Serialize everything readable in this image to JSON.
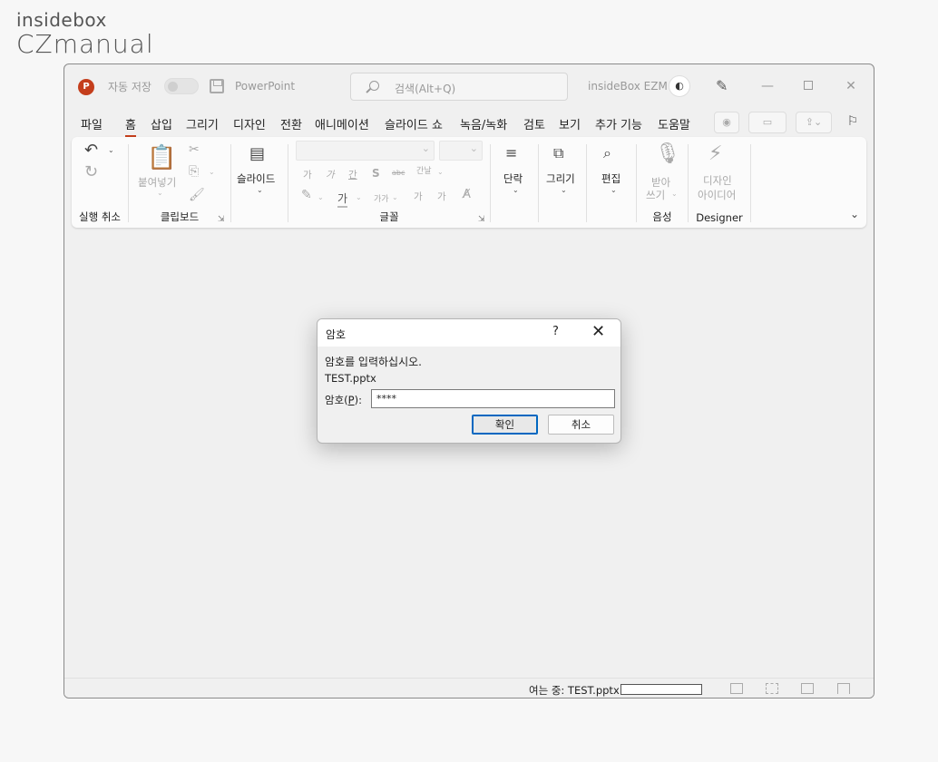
{
  "watermark": {
    "line1": "insidebox",
    "line2": "CZmanual"
  },
  "titlebar": {
    "app_logo": "P",
    "autosave_label": "자동 저장",
    "app_title": "PowerPoint",
    "search_placeholder": "검색(Alt+Q)",
    "user_name": "insideBox EZM",
    "avatar_icon": "avatar-icon",
    "window_controls": {
      "minimize": "—",
      "close": "✕"
    }
  },
  "menu": {
    "tabs": [
      "파일",
      "홈",
      "삽입",
      "그리기",
      "디자인",
      "전환",
      "애니메이션",
      "슬라이드 쇼",
      "녹음/녹화",
      "검토",
      "보기",
      "추가 기능",
      "도움말"
    ],
    "active_tab": "홈"
  },
  "ribbon": {
    "undo_group": {
      "label": "실행 취소"
    },
    "clipboard_group": {
      "label": "클립보드",
      "paste_label": "붙여넣기"
    },
    "slides_group": {
      "new_slide_label": "슬라이드"
    },
    "font_group": {
      "label": "글꼴",
      "row1": [
        "가",
        "가",
        "간",
        "S",
        "abc",
        "간날"
      ],
      "row2": [
        "가",
        "가가",
        "가",
        "가"
      ]
    },
    "paragraph": {
      "label": "단락"
    },
    "drawing": {
      "label": "그리기"
    },
    "editing": {
      "label": "편집"
    },
    "voice_group": {
      "label": "음성",
      "dictate_line1": "받아",
      "dictate_line2": "쓰기"
    },
    "designer_group": {
      "label": "Designer",
      "ideas_line1": "디자인",
      "ideas_line2": "아이디어"
    }
  },
  "dialog": {
    "title": "암호",
    "help": "?",
    "close": "✕",
    "prompt": "암호를 입력하십시오.",
    "filename": "TEST.pptx",
    "field_label_prefix": "암호(",
    "field_label_key": "P",
    "field_label_suffix": "):",
    "password_value": "****",
    "ok_label": "확인",
    "cancel_label": "취소"
  },
  "statusbar": {
    "opening_text": "여는 중: TEST.pptx",
    "progress": 0
  },
  "colors": {
    "accent": "#c43e1c",
    "dialog_focus": "#0067c0"
  }
}
